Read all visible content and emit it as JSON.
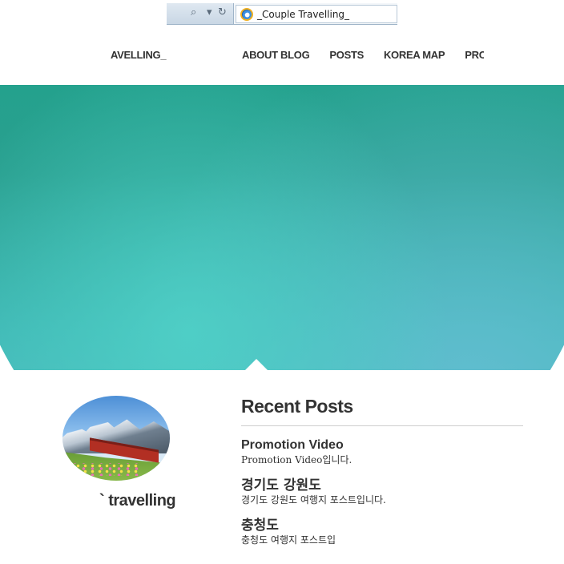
{
  "browser": {
    "nav_glyphs": [
      "⌕",
      "▾",
      "↻"
    ],
    "tab_title": "_Couple Travelling_"
  },
  "site": {
    "brand": "AVELLING_",
    "menu": [
      "ABOUT BLOG",
      "POSTS",
      "KOREA MAP",
      "PRO"
    ]
  },
  "profile": {
    "name": "` travelling"
  },
  "recent": {
    "heading": "Recent Posts",
    "posts": [
      {
        "title": "Promotion Video",
        "desc": "Promotion Video입니다."
      },
      {
        "title": "경기도 강원도",
        "desc": "경기도 강원도 여행지 포스트입니다."
      },
      {
        "title": "충청도",
        "desc": "충청도 여행지 포스트입"
      }
    ]
  },
  "colors": {
    "hero_top": "#17a386",
    "hero_bottom": "#5bbfcb",
    "text": "#333333"
  }
}
